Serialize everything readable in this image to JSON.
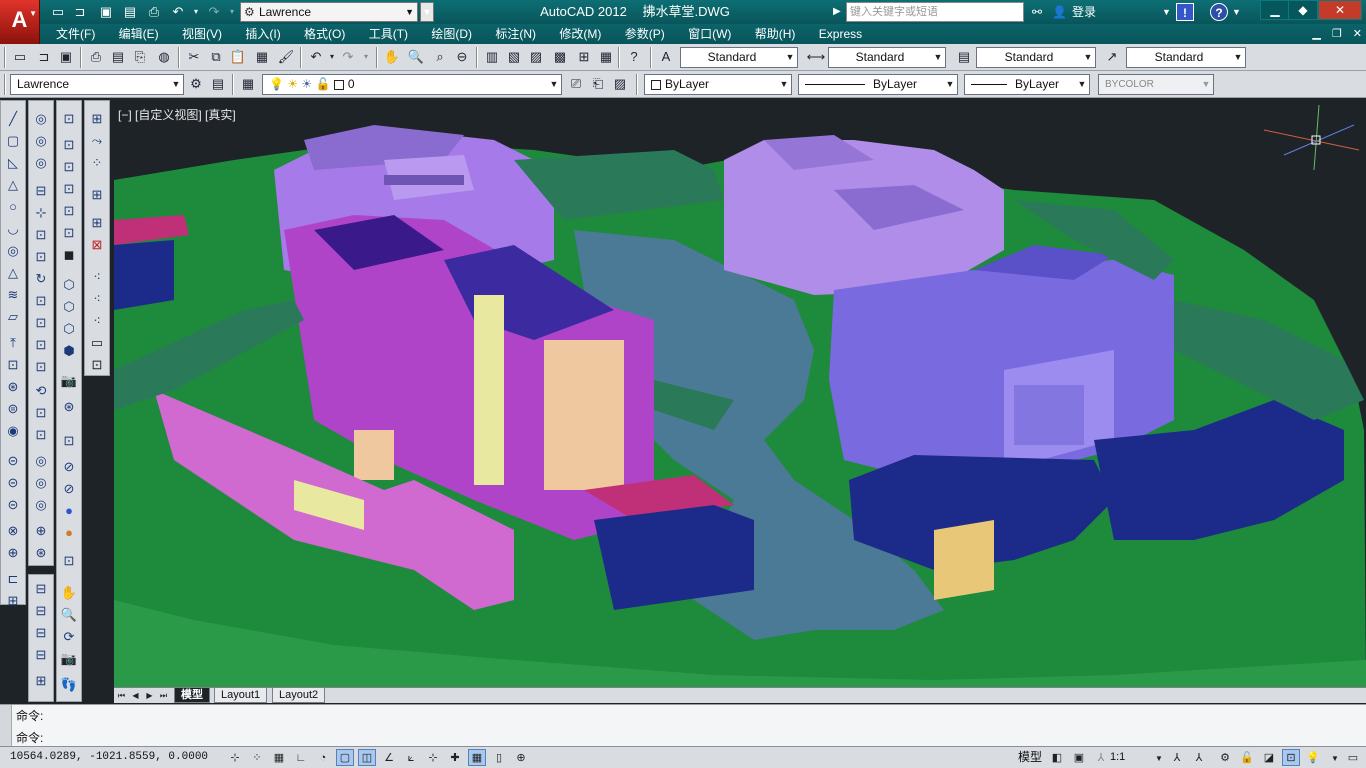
{
  "title_bar": {
    "app_name": "AutoCAD 2012",
    "document": "拂水草堂.DWG",
    "workspace": "Lawrence",
    "search_placeholder": "键入关键字或短语",
    "login_label": "登录"
  },
  "menu": {
    "items": [
      "文件(F)",
      "编辑(E)",
      "视图(V)",
      "插入(I)",
      "格式(O)",
      "工具(T)",
      "绘图(D)",
      "标注(N)",
      "修改(M)",
      "参数(P)",
      "窗口(W)",
      "帮助(H)",
      "Express"
    ]
  },
  "styles_toolbar": {
    "text_style": "Standard",
    "dim_style": "Standard",
    "table_style": "Standard",
    "mleader_style": "Standard"
  },
  "layers_toolbar": {
    "workspace": "Lawrence",
    "current_layer": "0",
    "color": "ByLayer",
    "linetype": "ByLayer",
    "lineweight": "ByLayer",
    "plot_style": "BYCOLOR"
  },
  "viewport": {
    "label": "[−] [自定义视图] [真实]"
  },
  "layout_tabs": {
    "tabs": [
      "模型",
      "Layout1",
      "Layout2"
    ],
    "active": "模型"
  },
  "command_line": {
    "history": "命令:",
    "prompt": "命令:"
  },
  "status_bar": {
    "coordinates": "10564.0289,  -1021.8559,  0.0000",
    "space": "模型",
    "annotation_scale": "1:1"
  },
  "colors": {
    "title_bar": "#0a5f64",
    "viewport_bg": "#1e2328",
    "ground": "#1e8a3c",
    "water": "#4a7a96",
    "building_violet": "#a67ae8",
    "building_magenta": "#b044c8",
    "roof_navy": "#1c2a8a"
  },
  "icons": {
    "quick_access": [
      "new-icon",
      "open-icon",
      "save-icon",
      "save-as-icon",
      "plot-icon",
      "undo-icon",
      "redo-icon"
    ]
  }
}
